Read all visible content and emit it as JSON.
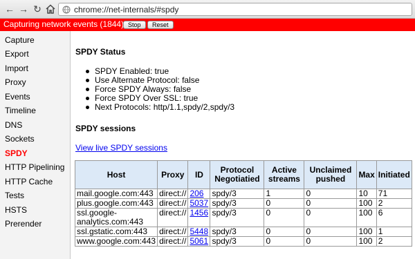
{
  "browser": {
    "url": "chrome://net-internals/#spdy"
  },
  "capture": {
    "status": "Capturing network events (1844)",
    "stop_label": "Stop",
    "reset_label": "Reset"
  },
  "sidebar": {
    "items": [
      {
        "label": "Capture"
      },
      {
        "label": "Export"
      },
      {
        "label": "Import"
      },
      {
        "label": "Proxy"
      },
      {
        "label": "Events"
      },
      {
        "label": "Timeline"
      },
      {
        "label": "DNS"
      },
      {
        "label": "Sockets"
      },
      {
        "label": "SPDY",
        "active": true
      },
      {
        "label": "HTTP Pipelining"
      },
      {
        "label": "HTTP Cache"
      },
      {
        "label": "Tests"
      },
      {
        "label": "HSTS"
      },
      {
        "label": "Prerender"
      }
    ]
  },
  "main": {
    "status_heading": "SPDY Status",
    "status_items": [
      "SPDY Enabled: true",
      "Use Alternate Protocol: false",
      "Force SPDY Always: false",
      "Force SPDY Over SSL: true",
      "Next Protocols: http/1.1,spdy/2,spdy/3"
    ],
    "sessions_heading": "SPDY sessions",
    "live_link": "View live SPDY sessions",
    "table": {
      "headers": [
        "Host",
        "Proxy",
        "ID",
        "Protocol Negotiatied",
        "Active streams",
        "Unclaimed pushed",
        "Max",
        "Initiated"
      ],
      "rows": [
        [
          "mail.google.com:443",
          "direct://",
          "206",
          "spdy/3",
          "1",
          "0",
          "10",
          "71"
        ],
        [
          "plus.google.com:443",
          "direct://",
          "5037",
          "spdy/3",
          "0",
          "0",
          "100",
          "2"
        ],
        [
          "ssl.google-analytics.com:443",
          "direct://",
          "1456",
          "spdy/3",
          "0",
          "0",
          "100",
          "6"
        ],
        [
          "ssl.gstatic.com:443",
          "direct://",
          "5448",
          "spdy/3",
          "0",
          "0",
          "100",
          "1"
        ],
        [
          "www.google.com:443",
          "direct://",
          "5061",
          "spdy/3",
          "0",
          "0",
          "100",
          "2"
        ]
      ]
    }
  }
}
